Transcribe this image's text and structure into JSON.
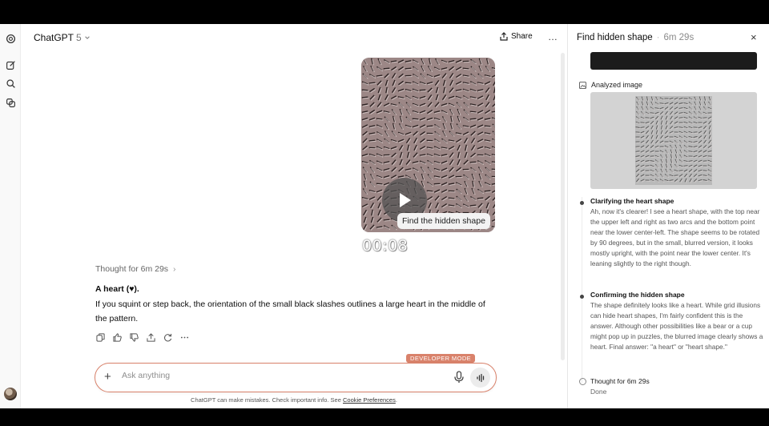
{
  "header": {
    "model_name": "ChatGPT",
    "model_version": "5",
    "share_label": "Share",
    "more_label": "…"
  },
  "video": {
    "caption": "Find the hidden shape",
    "timer": "00:08"
  },
  "message": {
    "thought_label": "Thought for 6m 29s",
    "answer_title": "A heart (♥).",
    "answer_body": "If you squint or step back, the orientation of the small black slashes outlines a large heart in the middle of the pattern."
  },
  "composer": {
    "badge": "DEVELOPER MODE",
    "placeholder": "Ask anything"
  },
  "disclaimer": {
    "text": "ChatGPT can make mistakes. Check important info. See",
    "link": "Cookie Preferences",
    "end": "."
  },
  "panel": {
    "title": "Find hidden shape",
    "separator": "·",
    "duration": "6m 29s",
    "close_label": "×",
    "analyzed_label": "Analyzed image",
    "steps": [
      {
        "title": "Clarifying the heart shape",
        "body": "Ah, now it's clearer! I see a heart shape, with the top near the upper left and right as two arcs and the bottom point near the lower center-left. The shape seems to be rotated by 90 degrees, but in the small, blurred version, it looks mostly upright, with the point near the lower center. It's leaning slightly to the right though."
      },
      {
        "title": "Confirming the hidden shape",
        "body": "The shape definitely looks like a heart. While grid illusions can hide heart shapes, I'm fairly confident this is the answer. Although other possibilities like a bear or a cup might pop up in puzzles, the blurred image clearly shows a heart. Final answer: \"a heart\" or \"heart shape.\""
      }
    ],
    "final_title": "Thought for 6m 29s",
    "final_sub": "Done"
  },
  "colors": {
    "accent": "#d9826b",
    "pattern_bg": "#9c8786",
    "panel_image_bg": "#d3d3d3"
  }
}
